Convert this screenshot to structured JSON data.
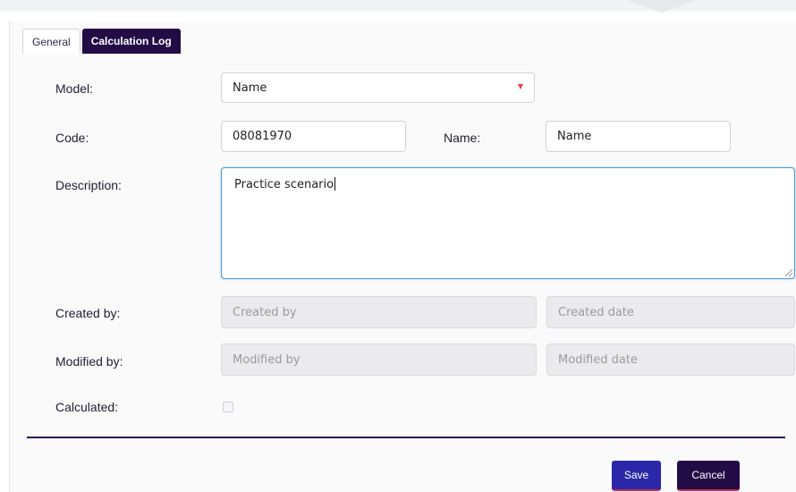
{
  "tabs": [
    {
      "label": "General",
      "active": true
    },
    {
      "label": "Calculation Log",
      "active": false
    }
  ],
  "form": {
    "model": {
      "label": "Model:",
      "value": "Name"
    },
    "code": {
      "label": "Code:",
      "value": "08081970"
    },
    "name": {
      "label": "Name:",
      "placeholder": "Name"
    },
    "description": {
      "label": "Description:",
      "value": "Practice scenario"
    },
    "created_by": {
      "label": "Created by:",
      "placeholder": "Created by"
    },
    "created_date": {
      "placeholder": "Created date"
    },
    "modified_by": {
      "label": "Modified by:",
      "placeholder": "Modified by"
    },
    "modified_date": {
      "placeholder": "Modified date"
    },
    "calculated": {
      "label": "Calculated:",
      "checked": false
    }
  },
  "actions": {
    "save_label": "Save",
    "cancel_label": "Cancel"
  },
  "colors": {
    "accent_dark": "#230b45",
    "save_blue": "#2a27a8",
    "dropdown_arrow": "#e23b4a",
    "focus_border": "#4a9bd8"
  }
}
